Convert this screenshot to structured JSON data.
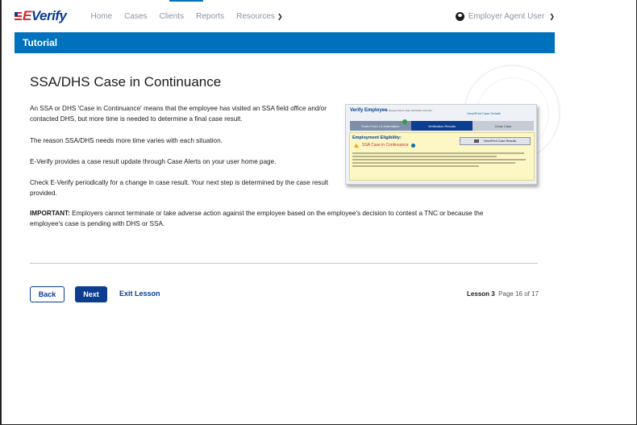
{
  "logo": {
    "text": "Verify",
    "prefix": "E"
  },
  "nav": {
    "links": [
      "Home",
      "Cases",
      "Clients",
      "Reports",
      "Resources"
    ],
    "user_name": "Employer Agent User"
  },
  "tutorial": {
    "label": "Tutorial"
  },
  "content": {
    "title": "SSA/DHS Case in Continuance",
    "paragraphs": [
      "An SSA or DHS 'Case in Continuance' means that the employee has visited an SSA field office and/or contacted DHS, but more time is needed to determine a final case result.",
      "The reason SSA/DHS needs more time varies with each situation.",
      "E-Verify provides a case result update through Case Alerts on your user home page.",
      "Check E-Verify periodically for a change in case result. Your next step is determined by the case result provided."
    ],
    "important_label": "IMPORTANT:",
    "important_text": " Employers cannot terminate or take adverse action against the employee based on the employee's decision to contest a TNC or because the employee's case is pending with DHS or SSA."
  },
  "screenshot": {
    "heading": "Verify Employee",
    "meta": "Employee Name  Case Verification Number",
    "view_link": "View/Print Case Details",
    "steps": [
      "Enter Form I-9 Information",
      "Verification Results",
      "Close Case"
    ],
    "eligibility_title": "Employment Eligibility:",
    "status": "SSA Case in Continuance",
    "print_button": "View/Print Case Results"
  },
  "footer": {
    "back_label": "Back",
    "next_label": "Next",
    "exit_label": "Exit Lesson",
    "lesson_label": "Lesson 3",
    "page_label": "Page 16 of 17"
  },
  "colors": {
    "primary": "#0071bc",
    "navy": "#0b3d91",
    "alert_red": "#d8262e"
  }
}
